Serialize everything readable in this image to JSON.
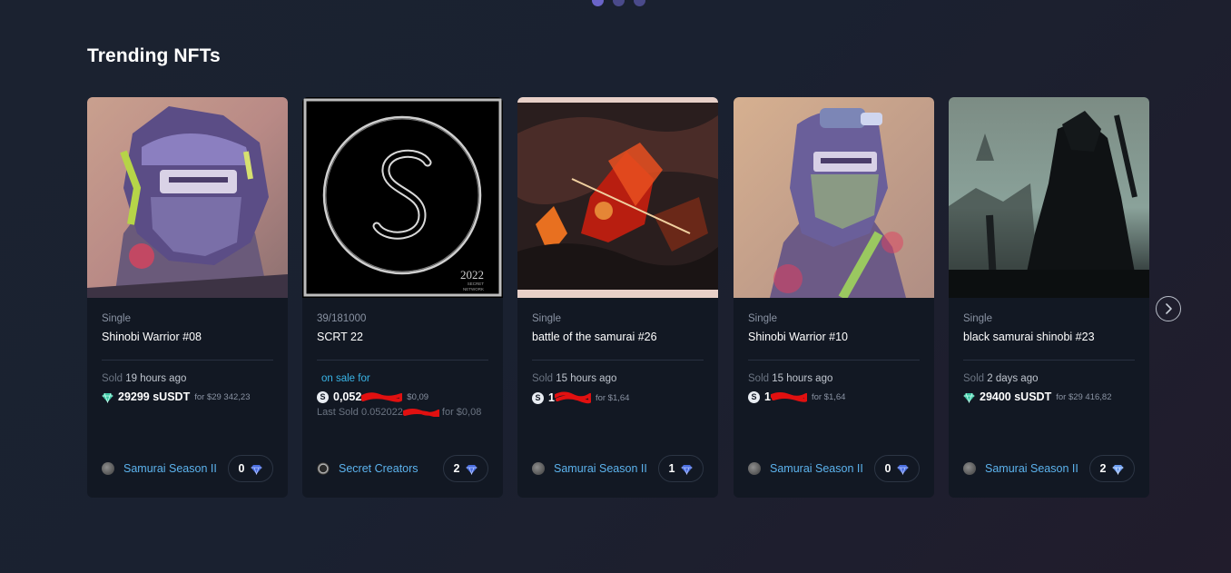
{
  "carousel": {
    "pages": 3,
    "active": 0
  },
  "section": {
    "title": "Trending NFTs"
  },
  "colors": {
    "accent_blue": "#5cb3ee",
    "on_sale_blue": "#39b4e6",
    "card_bg": "#121823",
    "redaction_red": "#e11010"
  },
  "cards": [
    {
      "image": "shinobi-warrior-portrait",
      "edition": "Single",
      "name": "Shinobi Warrior #08",
      "status_label": "Sold",
      "status_value": "19 hours ago",
      "currency_icon": "diamond-icon",
      "price": "29299 sUSDT",
      "price_usd": "for $29 342,23",
      "collection": "Samurai Season II",
      "likes": "0"
    },
    {
      "image": "secret-network-logo",
      "edition": "39/181000",
      "name": "SCRT 22",
      "status_label": "on sale for",
      "currency_icon": "coin-icon",
      "price": "0,052",
      "price_usd": "$0,09",
      "last_sold_label": "Last Sold",
      "last_sold_value": "0.052022",
      "last_sold_usd": "for $0,08",
      "collection": "Secret Creators",
      "likes": "2"
    },
    {
      "image": "battle-of-the-samurai",
      "edition": "Single",
      "name": "battle of the samurai #26",
      "status_label": "Sold",
      "status_value": "15 hours ago",
      "currency_icon": "coin-icon",
      "price": "1",
      "price_usd": "for $1,64",
      "collection": "Samurai Season II",
      "likes": "1"
    },
    {
      "image": "shinobi-warrior-portrait-2",
      "edition": "Single",
      "name": "Shinobi Warrior #10",
      "status_label": "Sold",
      "status_value": "15 hours ago",
      "currency_icon": "coin-icon",
      "price": "1",
      "price_usd": "for $1,64",
      "collection": "Samurai Season II",
      "likes": "0"
    },
    {
      "image": "black-samurai-silhouette",
      "edition": "Single",
      "name": "black samurai shinobi #23",
      "status_label": "Sold",
      "status_value": "2 days ago",
      "currency_icon": "diamond-icon",
      "price": "29400 sUSDT",
      "price_usd": "for $29 416,82",
      "collection": "Samurai Season II",
      "likes": "2"
    }
  ],
  "logo_2022": {
    "year": "2022",
    "line1": "SECRET",
    "line2": "NETWORK"
  },
  "next_button": {
    "icon": "chevron-right-icon"
  }
}
